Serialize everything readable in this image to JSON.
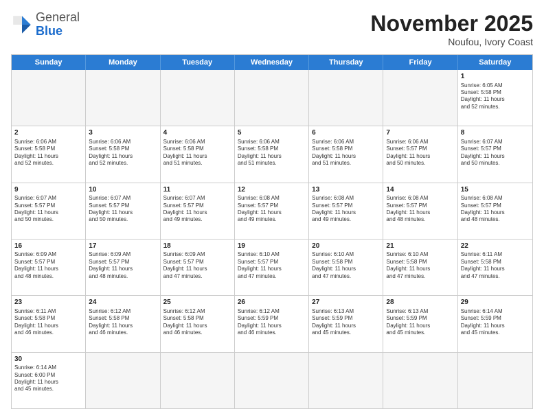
{
  "header": {
    "logo_general": "General",
    "logo_blue": "Blue",
    "month_title": "November 2025",
    "subtitle": "Noufou, Ivory Coast"
  },
  "weekdays": [
    "Sunday",
    "Monday",
    "Tuesday",
    "Wednesday",
    "Thursday",
    "Friday",
    "Saturday"
  ],
  "rows": [
    [
      {
        "day": "",
        "info": ""
      },
      {
        "day": "",
        "info": ""
      },
      {
        "day": "",
        "info": ""
      },
      {
        "day": "",
        "info": ""
      },
      {
        "day": "",
        "info": ""
      },
      {
        "day": "",
        "info": ""
      },
      {
        "day": "1",
        "info": "Sunrise: 6:05 AM\nSunset: 5:58 PM\nDaylight: 11 hours\nand 52 minutes."
      }
    ],
    [
      {
        "day": "2",
        "info": "Sunrise: 6:06 AM\nSunset: 5:58 PM\nDaylight: 11 hours\nand 52 minutes."
      },
      {
        "day": "3",
        "info": "Sunrise: 6:06 AM\nSunset: 5:58 PM\nDaylight: 11 hours\nand 52 minutes."
      },
      {
        "day": "4",
        "info": "Sunrise: 6:06 AM\nSunset: 5:58 PM\nDaylight: 11 hours\nand 51 minutes."
      },
      {
        "day": "5",
        "info": "Sunrise: 6:06 AM\nSunset: 5:58 PM\nDaylight: 11 hours\nand 51 minutes."
      },
      {
        "day": "6",
        "info": "Sunrise: 6:06 AM\nSunset: 5:58 PM\nDaylight: 11 hours\nand 51 minutes."
      },
      {
        "day": "7",
        "info": "Sunrise: 6:06 AM\nSunset: 5:57 PM\nDaylight: 11 hours\nand 50 minutes."
      },
      {
        "day": "8",
        "info": "Sunrise: 6:07 AM\nSunset: 5:57 PM\nDaylight: 11 hours\nand 50 minutes."
      }
    ],
    [
      {
        "day": "9",
        "info": "Sunrise: 6:07 AM\nSunset: 5:57 PM\nDaylight: 11 hours\nand 50 minutes."
      },
      {
        "day": "10",
        "info": "Sunrise: 6:07 AM\nSunset: 5:57 PM\nDaylight: 11 hours\nand 50 minutes."
      },
      {
        "day": "11",
        "info": "Sunrise: 6:07 AM\nSunset: 5:57 PM\nDaylight: 11 hours\nand 49 minutes."
      },
      {
        "day": "12",
        "info": "Sunrise: 6:08 AM\nSunset: 5:57 PM\nDaylight: 11 hours\nand 49 minutes."
      },
      {
        "day": "13",
        "info": "Sunrise: 6:08 AM\nSunset: 5:57 PM\nDaylight: 11 hours\nand 49 minutes."
      },
      {
        "day": "14",
        "info": "Sunrise: 6:08 AM\nSunset: 5:57 PM\nDaylight: 11 hours\nand 48 minutes."
      },
      {
        "day": "15",
        "info": "Sunrise: 6:08 AM\nSunset: 5:57 PM\nDaylight: 11 hours\nand 48 minutes."
      }
    ],
    [
      {
        "day": "16",
        "info": "Sunrise: 6:09 AM\nSunset: 5:57 PM\nDaylight: 11 hours\nand 48 minutes."
      },
      {
        "day": "17",
        "info": "Sunrise: 6:09 AM\nSunset: 5:57 PM\nDaylight: 11 hours\nand 48 minutes."
      },
      {
        "day": "18",
        "info": "Sunrise: 6:09 AM\nSunset: 5:57 PM\nDaylight: 11 hours\nand 47 minutes."
      },
      {
        "day": "19",
        "info": "Sunrise: 6:10 AM\nSunset: 5:57 PM\nDaylight: 11 hours\nand 47 minutes."
      },
      {
        "day": "20",
        "info": "Sunrise: 6:10 AM\nSunset: 5:58 PM\nDaylight: 11 hours\nand 47 minutes."
      },
      {
        "day": "21",
        "info": "Sunrise: 6:10 AM\nSunset: 5:58 PM\nDaylight: 11 hours\nand 47 minutes."
      },
      {
        "day": "22",
        "info": "Sunrise: 6:11 AM\nSunset: 5:58 PM\nDaylight: 11 hours\nand 47 minutes."
      }
    ],
    [
      {
        "day": "23",
        "info": "Sunrise: 6:11 AM\nSunset: 5:58 PM\nDaylight: 11 hours\nand 46 minutes."
      },
      {
        "day": "24",
        "info": "Sunrise: 6:12 AM\nSunset: 5:58 PM\nDaylight: 11 hours\nand 46 minutes."
      },
      {
        "day": "25",
        "info": "Sunrise: 6:12 AM\nSunset: 5:58 PM\nDaylight: 11 hours\nand 46 minutes."
      },
      {
        "day": "26",
        "info": "Sunrise: 6:12 AM\nSunset: 5:59 PM\nDaylight: 11 hours\nand 46 minutes."
      },
      {
        "day": "27",
        "info": "Sunrise: 6:13 AM\nSunset: 5:59 PM\nDaylight: 11 hours\nand 45 minutes."
      },
      {
        "day": "28",
        "info": "Sunrise: 6:13 AM\nSunset: 5:59 PM\nDaylight: 11 hours\nand 45 minutes."
      },
      {
        "day": "29",
        "info": "Sunrise: 6:14 AM\nSunset: 5:59 PM\nDaylight: 11 hours\nand 45 minutes."
      }
    ],
    [
      {
        "day": "30",
        "info": "Sunrise: 6:14 AM\nSunset: 6:00 PM\nDaylight: 11 hours\nand 45 minutes."
      },
      {
        "day": "",
        "info": ""
      },
      {
        "day": "",
        "info": ""
      },
      {
        "day": "",
        "info": ""
      },
      {
        "day": "",
        "info": ""
      },
      {
        "day": "",
        "info": ""
      },
      {
        "day": "",
        "info": ""
      }
    ]
  ]
}
